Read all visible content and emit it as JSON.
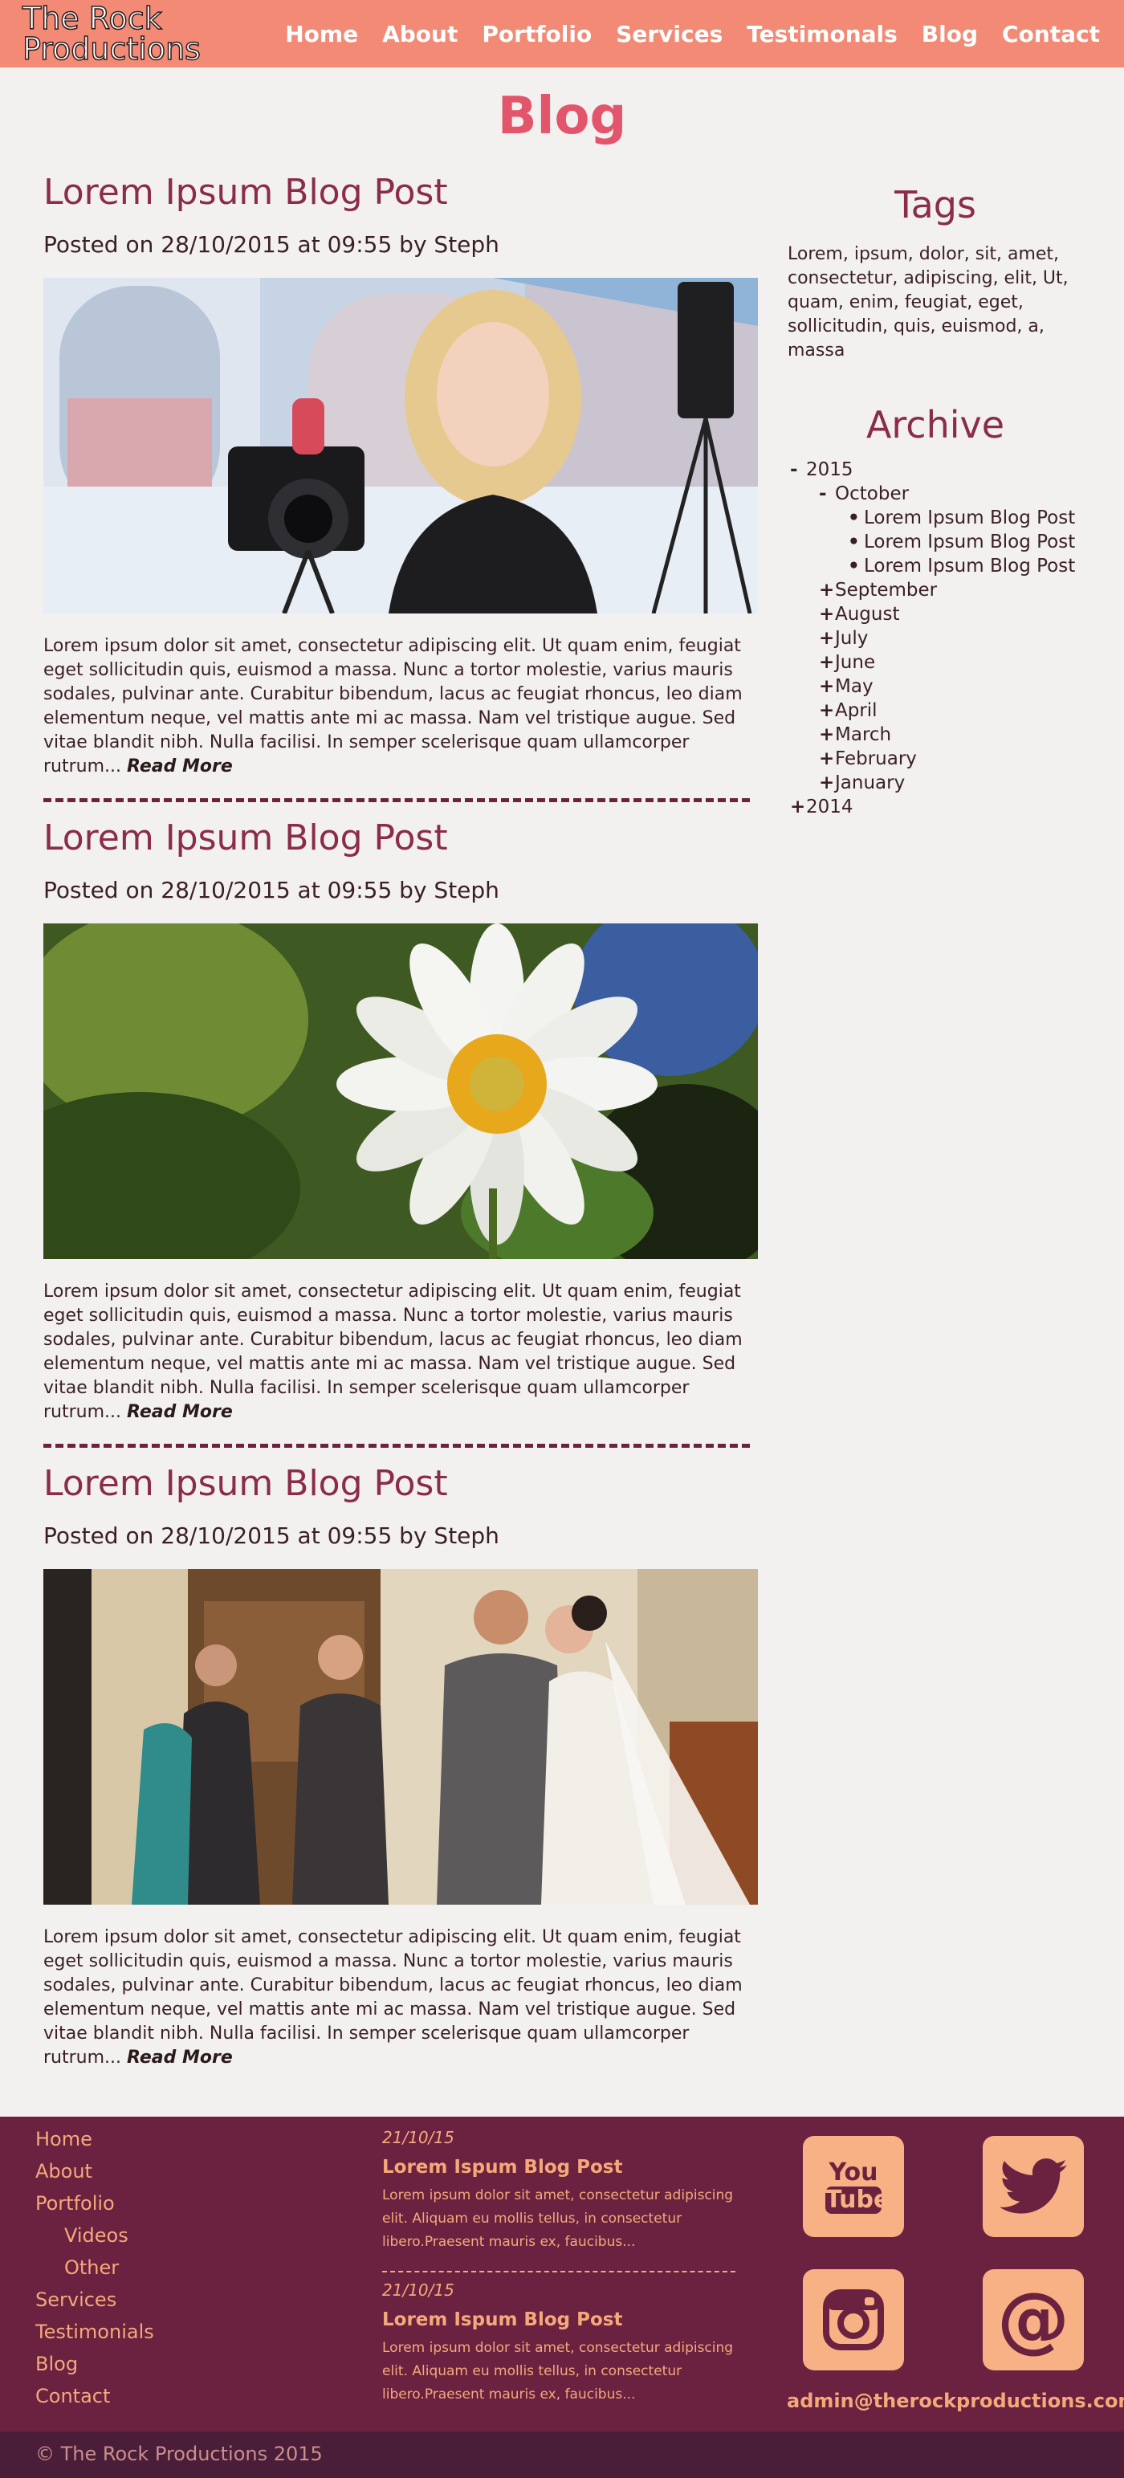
{
  "header": {
    "logo_line1": "The Rock",
    "logo_line2": "Productions",
    "nav": [
      "Home",
      "About",
      "Portfolio",
      "Services",
      "Testimonals",
      "Blog",
      "Contact"
    ]
  },
  "page_title": "Blog",
  "posts": [
    {
      "title": "Lorem Ipsum Blog Post",
      "meta": "Posted on 28/10/2015 at 09:55 by Steph",
      "text": "Lorem ipsum dolor sit amet, consectetur adipiscing elit. Ut quam enim, feugiat eget sollicitudin quis, euismod a massa. Nunc a tortor molestie, varius mauris sodales, pulvinar ante. Curabitur bibendum, lacus ac feugiat rhoncus, leo diam elementum neque, vel mattis ante mi ac massa. Nam vel tristique augue. Sed vitae blandit nibh. Nulla facilisi. In semper scelerisque quam ullamcorper rutrum...",
      "read_more": "Read More"
    },
    {
      "title": "Lorem Ipsum Blog Post",
      "meta": "Posted on 28/10/2015 at 09:55 by Steph",
      "text": "Lorem ipsum dolor sit amet, consectetur adipiscing elit. Ut quam enim, feugiat eget sollicitudin quis, euismod a massa. Nunc a tortor molestie, varius mauris sodales, pulvinar ante. Curabitur bibendum, lacus ac feugiat rhoncus, leo diam elementum neque, vel mattis ante mi ac massa. Nam vel tristique augue. Sed vitae blandit nibh. Nulla facilisi. In semper scelerisque quam ullamcorper rutrum...",
      "read_more": "Read More"
    },
    {
      "title": "Lorem Ipsum Blog Post",
      "meta": "Posted on 28/10/2015 at 09:55 by Steph",
      "text": "Lorem ipsum dolor sit amet, consectetur adipiscing elit. Ut quam enim, feugiat eget sollicitudin quis, euismod a massa. Nunc a tortor molestie, varius mauris sodales, pulvinar ante. Curabitur bibendum, lacus ac feugiat rhoncus, leo diam elementum neque, vel mattis ante mi ac massa. Nam vel tristique augue. Sed vitae blandit nibh. Nulla facilisi. In semper scelerisque quam ullamcorper rutrum...",
      "read_more": "Read More"
    }
  ],
  "sidebar": {
    "tags_heading": "Tags",
    "tags_text": "Lorem, ipsum, dolor, sit, amet, consectetur, adipiscing, elit, Ut, quam, enim, feugiat, eget, sollicitudin, quis, euismod, a, massa",
    "archive_heading": "Archive",
    "archive": [
      {
        "sym": "-",
        "label": "2015"
      },
      {
        "sym": "-",
        "label": "October"
      },
      {
        "sym": "•",
        "label": "Lorem Ipsum Blog Post"
      },
      {
        "sym": "•",
        "label": "Lorem Ipsum Blog Post"
      },
      {
        "sym": "•",
        "label": "Lorem Ipsum Blog Post"
      },
      {
        "sym": "+",
        "label": "September"
      },
      {
        "sym": "+",
        "label": "August"
      },
      {
        "sym": "+",
        "label": "July"
      },
      {
        "sym": "+",
        "label": "June"
      },
      {
        "sym": "+",
        "label": "May"
      },
      {
        "sym": "+",
        "label": "April"
      },
      {
        "sym": "+",
        "label": "March"
      },
      {
        "sym": "+",
        "label": "February"
      },
      {
        "sym": "+",
        "label": "January"
      },
      {
        "sym": "+",
        "label": "2014"
      }
    ]
  },
  "footer": {
    "links": [
      "Home",
      "About",
      "Portfolio",
      "Videos",
      "Other",
      "Services",
      "Testimonials",
      "Blog",
      "Contact"
    ],
    "news": [
      {
        "date": "21/10/15",
        "title": "Lorem Ispum Blog Post",
        "body": "Lorem ipsum dolor sit amet, consectetur adipiscing elit. Aliquam eu mollis tellus, in consectetur libero.Praesent mauris ex, faucibus..."
      },
      {
        "date": "21/10/15",
        "title": "Lorem Ispum Blog Post",
        "body": "Lorem ipsum dolor sit amet, consectetur adipiscing elit. Aliquam eu mollis tellus, in consectetur libero.Praesent mauris ex, faucibus..."
      }
    ],
    "social": {
      "youtube_line1": "You",
      "youtube_line2": "Tube",
      "at_symbol": "@"
    },
    "email": "admin@therockproductions.com",
    "copyright": "© The Rock Productions 2015"
  },
  "colors": {
    "header_bg": "#f28a76",
    "accent_title": "#e3556a",
    "post_title": "#8a2c4a",
    "footer_bg": "#6a2240",
    "footer_text": "#f5a97a",
    "bottom_bar": "#4a1e38"
  }
}
